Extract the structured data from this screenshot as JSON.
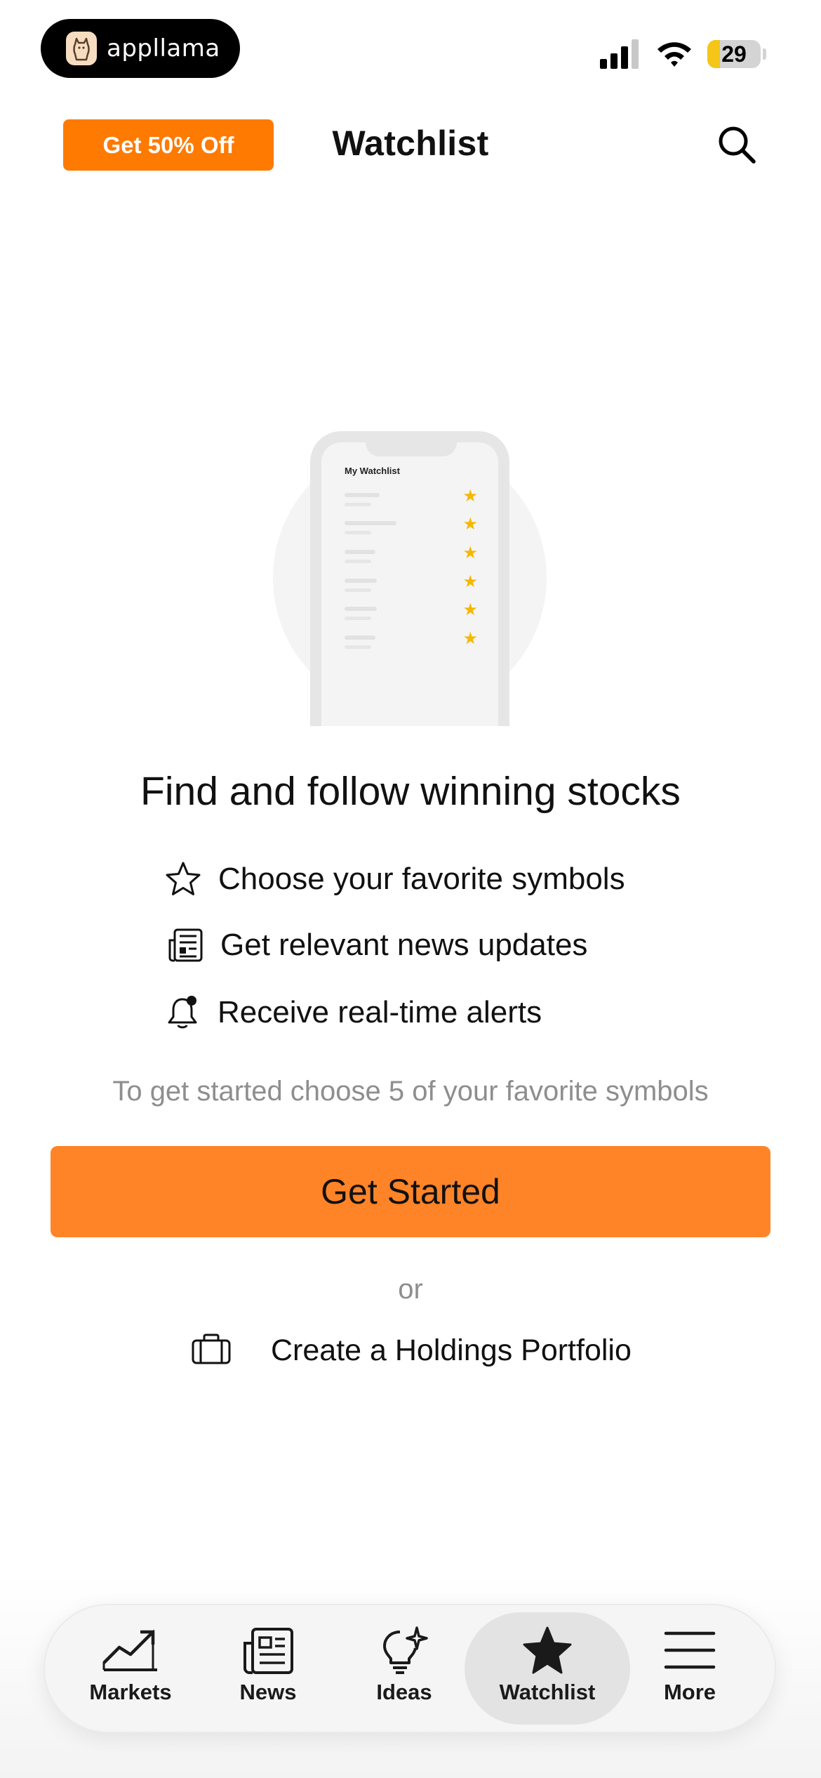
{
  "status_bar": {
    "app_badge": "appllama",
    "battery": "29"
  },
  "header": {
    "promo_label": "Get 50% Off",
    "title": "Watchlist"
  },
  "illustration": {
    "phone_title": "My Watchlist"
  },
  "empty_state": {
    "headline": "Find and follow winning stocks",
    "features": [
      {
        "icon": "star-outline-icon",
        "label": "Choose your favorite symbols"
      },
      {
        "icon": "newspaper-icon",
        "label": "Get relevant news updates"
      },
      {
        "icon": "bell-alert-icon",
        "label": "Receive real-time alerts"
      }
    ],
    "helper_text": "To get started choose 5 of your favorite symbols",
    "cta_label": "Get Started",
    "or_text": "or",
    "portfolio_link": "Create a Holdings Portfolio"
  },
  "tab_bar": {
    "active": "Watchlist",
    "tabs": [
      {
        "icon": "chart-trend-icon",
        "label": "Markets"
      },
      {
        "icon": "newspaper-icon",
        "label": "News"
      },
      {
        "icon": "lightbulb-sparkle-icon",
        "label": "Ideas"
      },
      {
        "icon": "star-filled-icon",
        "label": "Watchlist"
      },
      {
        "icon": "menu-icon",
        "label": "More"
      }
    ]
  },
  "colors": {
    "promo": "#ff7a00",
    "cta": "#ff8428",
    "star": "#f5b800",
    "battery_low": "#f5c518"
  }
}
